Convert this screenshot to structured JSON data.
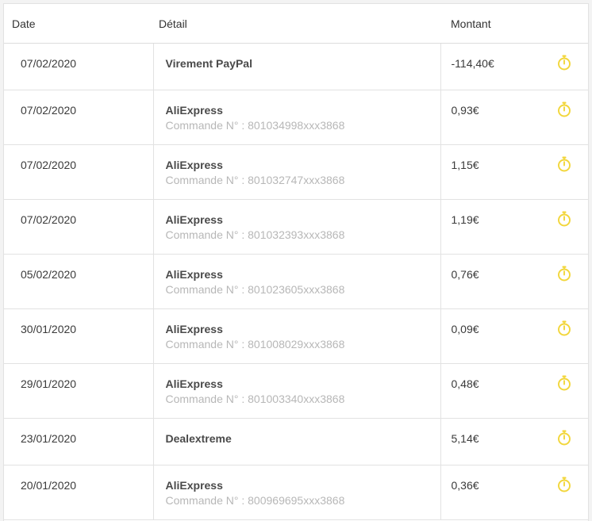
{
  "table": {
    "headers": {
      "date": "Date",
      "detail": "Détail",
      "amount": "Montant"
    },
    "rows": [
      {
        "date": "07/02/2020",
        "merchant": "Virement PayPal",
        "order": "",
        "amount": "-114,40€",
        "status_icon": "stopwatch-icon"
      },
      {
        "date": "07/02/2020",
        "merchant": "AliExpress",
        "order": "Commande N° : 801034998xxx3868",
        "amount": "0,93€",
        "status_icon": "stopwatch-icon"
      },
      {
        "date": "07/02/2020",
        "merchant": "AliExpress",
        "order": "Commande N° : 801032747xxx3868",
        "amount": "1,15€",
        "status_icon": "stopwatch-icon"
      },
      {
        "date": "07/02/2020",
        "merchant": "AliExpress",
        "order": "Commande N° : 801032393xxx3868",
        "amount": "1,19€",
        "status_icon": "stopwatch-icon"
      },
      {
        "date": "05/02/2020",
        "merchant": "AliExpress",
        "order": "Commande N° : 801023605xxx3868",
        "amount": "0,76€",
        "status_icon": "stopwatch-icon"
      },
      {
        "date": "30/01/2020",
        "merchant": "AliExpress",
        "order": "Commande N° : 801008029xxx3868",
        "amount": "0,09€",
        "status_icon": "stopwatch-icon"
      },
      {
        "date": "29/01/2020",
        "merchant": "AliExpress",
        "order": "Commande N° : 801003340xxx3868",
        "amount": "0,48€",
        "status_icon": "stopwatch-icon"
      },
      {
        "date": "23/01/2020",
        "merchant": "Dealextreme",
        "order": "",
        "amount": "5,14€",
        "status_icon": "stopwatch-icon"
      },
      {
        "date": "20/01/2020",
        "merchant": "AliExpress",
        "order": "Commande N° : 800969695xxx3868",
        "amount": "0,36€",
        "status_icon": "stopwatch-icon"
      }
    ]
  },
  "colors": {
    "pending_icon": "#f2d63a",
    "secondary_text": "#b7b7b7",
    "divider": "#e2e2e2"
  }
}
